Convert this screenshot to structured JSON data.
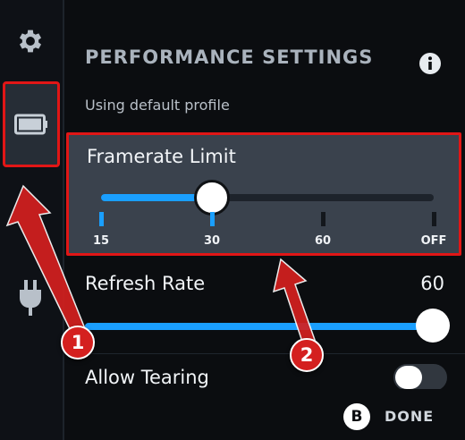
{
  "sidebar": {
    "items": [
      {
        "icon": "gear-icon"
      },
      {
        "icon": "battery-icon"
      },
      {
        "icon": "plug-icon"
      }
    ]
  },
  "main": {
    "title": "PERFORMANCE SETTINGS",
    "profile_text": "Using default profile",
    "info_icon": "info-icon"
  },
  "framerate": {
    "label": "Framerate Limit",
    "options": [
      "15",
      "30",
      "60",
      "OFF"
    ],
    "selected": "30",
    "selected_fraction": 0.333
  },
  "refresh_rate": {
    "label": "Refresh Rate",
    "value": "60",
    "fraction": 1.0
  },
  "tearing": {
    "label": "Allow Tearing",
    "enabled": false
  },
  "footer": {
    "button_glyph": "B",
    "done_label": "DONE"
  },
  "annotations": [
    {
      "number": "1"
    },
    {
      "number": "2"
    }
  ],
  "colors": {
    "accent": "#1a9fff",
    "highlight_border": "#e11616",
    "callout": "#d4201f"
  }
}
